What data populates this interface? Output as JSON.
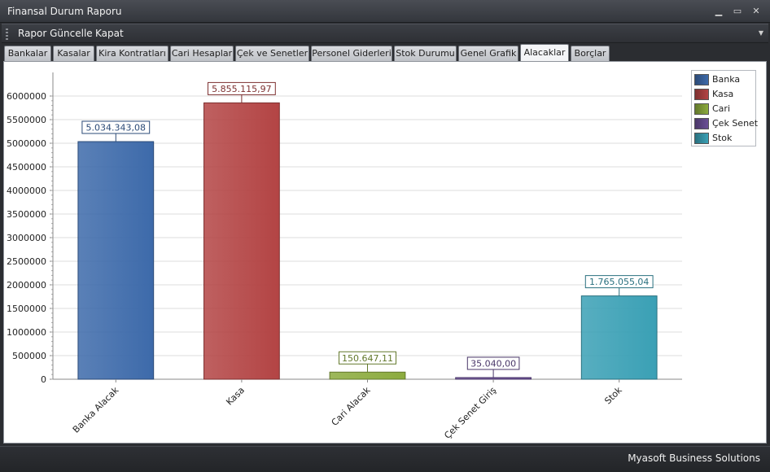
{
  "window": {
    "title": "Finansal Durum Raporu"
  },
  "menu": {
    "items": [
      "Rapor Güncelle",
      "Kapat"
    ]
  },
  "tabs": [
    {
      "label": "Bankalar"
    },
    {
      "label": "Kasalar"
    },
    {
      "label": "Kira Kontratları"
    },
    {
      "label": "Cari Hesaplar"
    },
    {
      "label": "Çek ve Senetler"
    },
    {
      "label": "Personel Giderleri"
    },
    {
      "label": "Stok Durumu"
    },
    {
      "label": "Genel Grafik"
    },
    {
      "label": "Alacaklar",
      "active": true
    },
    {
      "label": "Borçlar"
    }
  ],
  "status": {
    "text": "Myasoft Business Solutions"
  },
  "chart_data": {
    "type": "bar",
    "categories": [
      "Banka Alacak",
      "Kasa",
      "Cari Alacak",
      "Çek Senet Giriş",
      "Stok"
    ],
    "values": [
      5034343.08,
      5855115.97,
      150647.11,
      35040.0,
      1765055.04
    ],
    "value_labels": [
      "5.034.343,08",
      "5.855.115,97",
      "150.647,11",
      "35.040,00",
      "1.765.055,04"
    ],
    "series": [
      {
        "name": "Banka",
        "color": "#3d6aaa"
      },
      {
        "name": "Kasa",
        "color": "#b34444"
      },
      {
        "name": "Cari",
        "color": "#8cab3e"
      },
      {
        "name": "Çek Senet",
        "color": "#6a4f96"
      },
      {
        "name": "Stok",
        "color": "#3aa0b5"
      }
    ],
    "ylim": [
      0,
      6500000
    ],
    "yticks": [
      0,
      500000,
      1000000,
      1500000,
      2000000,
      2500000,
      3000000,
      3500000,
      4000000,
      4500000,
      5000000,
      5500000,
      6000000
    ],
    "grid": true,
    "legend_position": "top-right"
  }
}
